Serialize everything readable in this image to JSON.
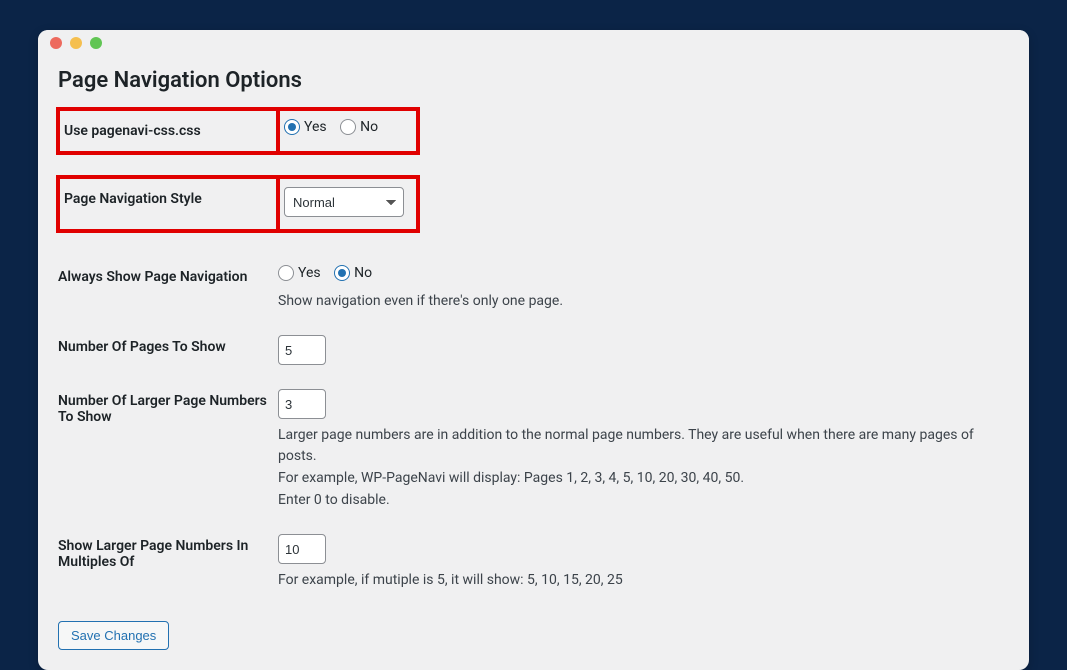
{
  "page_title": "Page Navigation Options",
  "yes_label": "Yes",
  "no_label": "No",
  "use_css": {
    "label": "Use pagenavi-css.css",
    "value": "yes"
  },
  "style": {
    "label": "Page Navigation Style",
    "value": "Normal"
  },
  "always_show": {
    "label": "Always Show Page Navigation",
    "value": "no",
    "desc": "Show navigation even if there's only one page."
  },
  "num_pages": {
    "label": "Number Of Pages To Show",
    "value": "5"
  },
  "num_larger": {
    "label": "Number Of Larger Page Numbers To Show",
    "value": "3",
    "desc1": "Larger page numbers are in addition to the normal page numbers. They are useful when there are many pages of posts.",
    "desc2": "For example, WP-PageNavi will display: Pages 1, 2, 3, 4, 5, 10, 20, 30, 40, 50.",
    "desc3": "Enter 0 to disable."
  },
  "multiples": {
    "label": "Show Larger Page Numbers In Multiples Of",
    "value": "10",
    "desc": "For example, if mutiple is 5, it will show: 5, 10, 15, 20, 25"
  },
  "save_label": "Save Changes"
}
